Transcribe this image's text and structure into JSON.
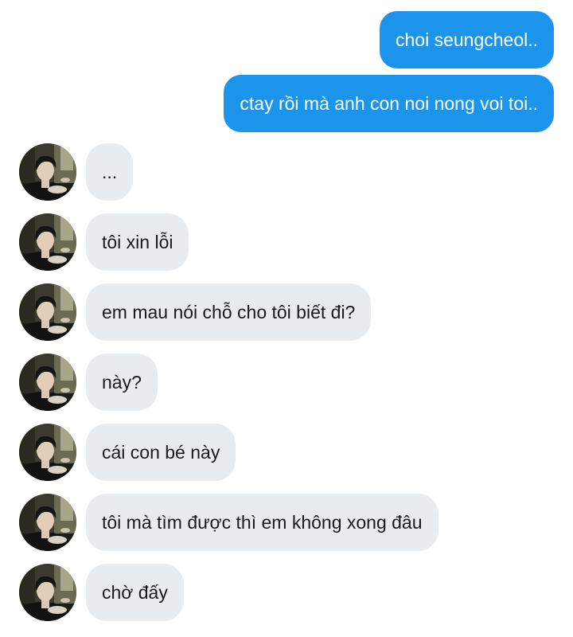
{
  "colors": {
    "outgoing_bubble": "#1b95eb",
    "outgoing_text": "#ffffff",
    "incoming_bubble": "#e8ecef",
    "incoming_text": "#1a1a1a"
  },
  "avatar": {
    "icon": "user-photo-avatar"
  },
  "messages": [
    {
      "direction": "outgoing",
      "text": "choi seungcheol.."
    },
    {
      "direction": "outgoing",
      "text": "ctay rồi mà anh con noi nong voi toi.."
    },
    {
      "direction": "incoming",
      "text": "..."
    },
    {
      "direction": "incoming",
      "text": "tôi xin lỗi"
    },
    {
      "direction": "incoming",
      "text": "em mau nói chỗ cho tôi biết đi?"
    },
    {
      "direction": "incoming",
      "text": "này?"
    },
    {
      "direction": "incoming",
      "text": "cái con bé này"
    },
    {
      "direction": "incoming",
      "text": "tôi mà tìm được thì em không xong đâu"
    },
    {
      "direction": "incoming",
      "text": "chờ đấy"
    }
  ]
}
